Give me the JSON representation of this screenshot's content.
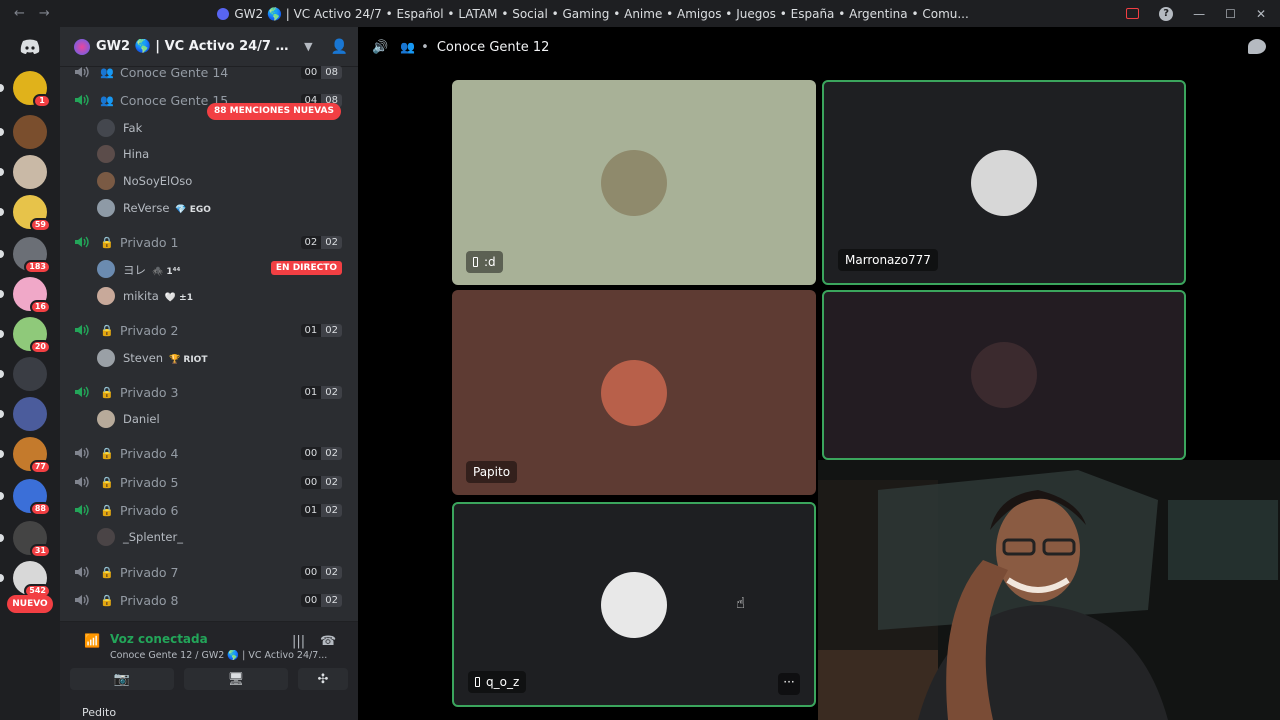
{
  "titlebar": {
    "back": "←",
    "forward": "→",
    "title": "GW2 🌎 | VC Activo 24/7 • Español • LATAM • Social • Gaming • Anime • Amigos • Juegos • España • Argentina • Comu...",
    "minimize": "—",
    "maximize": "☐",
    "close": "✕"
  },
  "rail": {
    "servers": [
      {
        "badge": "1",
        "color": "#e0b21b"
      },
      {
        "badge": "",
        "color": "#7a4e2d"
      },
      {
        "badge": "",
        "color": "#c9b9a6"
      },
      {
        "badge": "59",
        "color": "#e7c34a"
      },
      {
        "badge": "183",
        "color": "#6b6f76"
      },
      {
        "badge": "16",
        "color": "#f0a8c8"
      },
      {
        "badge": "20",
        "color": "#8fc97a"
      },
      {
        "badge": "",
        "color": "#3a3d44"
      },
      {
        "badge": "",
        "color": "#4b5c9c"
      },
      {
        "badge": "77",
        "color": "#c47a2c"
      },
      {
        "badge": "88",
        "color": "#3b6fd8"
      },
      {
        "badge": "31",
        "color": "#444"
      },
      {
        "badge": "542",
        "color": "#d8d8d8"
      }
    ],
    "new_label": "NUEVO"
  },
  "server": {
    "name": "GW2 🌎 | VC Activo 24/7 • Espa...",
    "mentions_label": "88 MENCIONES NUEVAS"
  },
  "channels": [
    {
      "name": "Conoce Gente 14",
      "a": "00",
      "b": "08",
      "group": true
    },
    {
      "name": "Conoce Gente 15",
      "a": "04",
      "b": "08",
      "group": true
    },
    {
      "name": "Privado 1",
      "a": "02",
      "b": "02"
    },
    {
      "name": "Privado 2",
      "a": "01",
      "b": "02"
    },
    {
      "name": "Privado 3",
      "a": "01",
      "b": "02"
    },
    {
      "name": "Privado 4",
      "a": "00",
      "b": "02"
    },
    {
      "name": "Privado 5",
      "a": "00",
      "b": "02"
    },
    {
      "name": "Privado 6",
      "a": "01",
      "b": "02"
    },
    {
      "name": "Privado 7",
      "a": "00",
      "b": "02"
    },
    {
      "name": "Privado 8",
      "a": "00",
      "b": "02"
    }
  ],
  "users": {
    "fak": "Fak",
    "hina": "Hina",
    "nosoy": "NoSoyElOso",
    "reverse": "ReVerse",
    "reverse_tag": "💎 EGO",
    "privado1_a": "ヨレ",
    "privado1_a_tag": "🕷️ 1⁴⁴",
    "live_label": "EN DIRECTO",
    "mikita": "mikita",
    "mikita_tag": "🤍 ±1",
    "steven": "Steven",
    "steven_tag": "🏆 RIOT",
    "daniel": "Daniel",
    "splenter": "_Splenter_"
  },
  "voice": {
    "status": "Voz conectada",
    "location": "Conoce Gente 12 / GW2 🌎 | VC Activo 24/7...",
    "btn_video": "📷",
    "btn_share": "🖥",
    "btn_activity": "✣",
    "footer_user": "Pedito"
  },
  "stage": {
    "channel_name": "Conoce Gente 12",
    "tiles": [
      {
        "label": ":d",
        "mobile": true,
        "bg": "#a8b197",
        "avatar": "#8f8a6c",
        "speaking": false
      },
      {
        "label": "Marronazo777",
        "mobile": false,
        "bg": "#1e1f22",
        "avatar": "#d7d7d7",
        "speaking": true
      },
      {
        "label": "Papito",
        "mobile": false,
        "bg": "#5e3b33",
        "avatar": "#b8604a",
        "speaking": false
      },
      {
        "label": "",
        "mobile": false,
        "bg": "#231c22",
        "avatar": "#3b2a2e",
        "speaking": true
      },
      {
        "label": "q_o_z",
        "mobile": true,
        "bg": "#1e1f22",
        "avatar": "#e8e8e8",
        "speaking": true
      }
    ],
    "more_label": "···"
  },
  "colors": {
    "accent": "#5865f2",
    "online": "#23a559",
    "danger": "#f23f43"
  }
}
